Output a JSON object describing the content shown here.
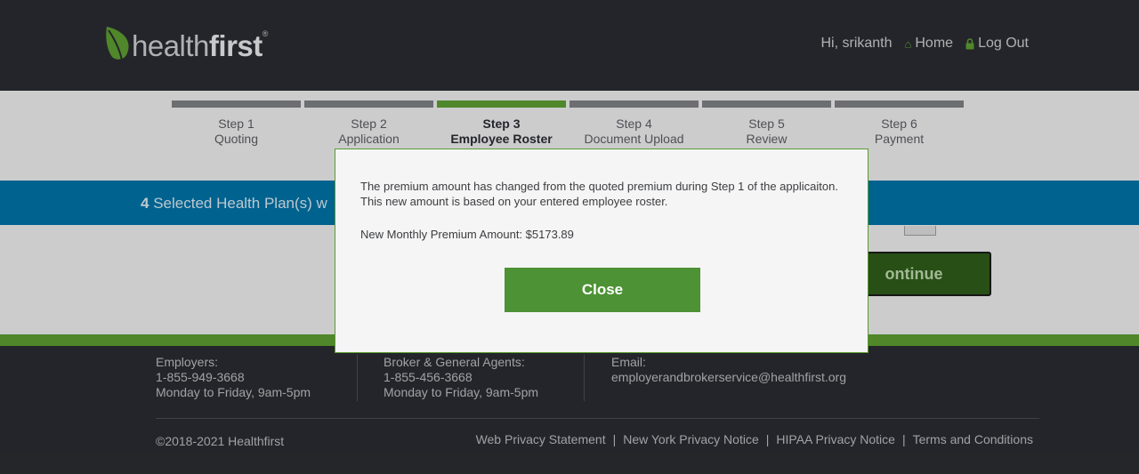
{
  "header": {
    "logo_light": "health",
    "logo_bold": "first",
    "logo_tm": "®",
    "greeting": "Hi, srikanth",
    "home_label": "Home",
    "logout_label": "Log Out"
  },
  "steps": [
    {
      "num": "Step 1",
      "label": "Quoting",
      "active": false
    },
    {
      "num": "Step 2",
      "label": "Application",
      "active": false
    },
    {
      "num": "Step 3",
      "label": "Employee Roster",
      "active": true
    },
    {
      "num": "Step 4",
      "label": "Document Upload",
      "active": false
    },
    {
      "num": "Step 5",
      "label": "Review",
      "active": false
    },
    {
      "num": "Step 6",
      "label": "Payment",
      "active": false
    }
  ],
  "plan_banner": {
    "count": "4",
    "text": "Selected Health Plan(s) w"
  },
  "continue_label": "ontinue",
  "footer": {
    "employers_title": "Employers:",
    "employers_phone": "1-855-949-3668",
    "employers_hours": "Monday to Friday, 9am-5pm",
    "broker_title": "Broker & General Agents:",
    "broker_phone": "1-855-456-3668",
    "broker_hours": "Monday to Friday, 9am-5pm",
    "email_title": "Email:",
    "email_address": "employerandbrokerservice@healthfirst.org",
    "copyright": "©2018-2021 Healthfirst",
    "links": [
      "Web Privacy Statement",
      "New York Privacy Notice",
      "HIPAA Privacy Notice",
      "Terms and Conditions"
    ],
    "separator": "|"
  },
  "modal": {
    "message": "The premium amount has changed from the quoted premium during Step 1 of the applicaiton. This new amount is based on your entered employee roster.",
    "premium_text": "New Monthly Premium Amount: $5173.89",
    "close_label": "Close"
  },
  "colors": {
    "brand_green": "#5b9a30",
    "banner_blue": "#0070a3",
    "dark_bg": "#2a2b30"
  }
}
